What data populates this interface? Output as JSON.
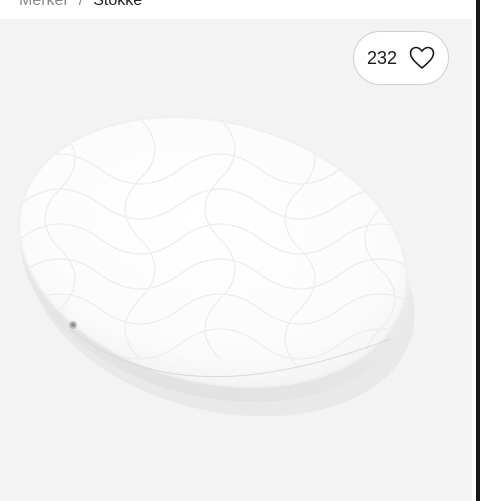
{
  "breadcrumb": {
    "items": [
      "Merker",
      "Stokke"
    ],
    "separator": "/"
  },
  "product": {
    "image_icon": "oval-mattress-image",
    "like_count": "232",
    "like_icon": "heart-outline-icon"
  },
  "colors": {
    "gallery_background": "#f3f3f3",
    "pill_border": "#cfcfcf",
    "text": "#1a1a1a"
  }
}
